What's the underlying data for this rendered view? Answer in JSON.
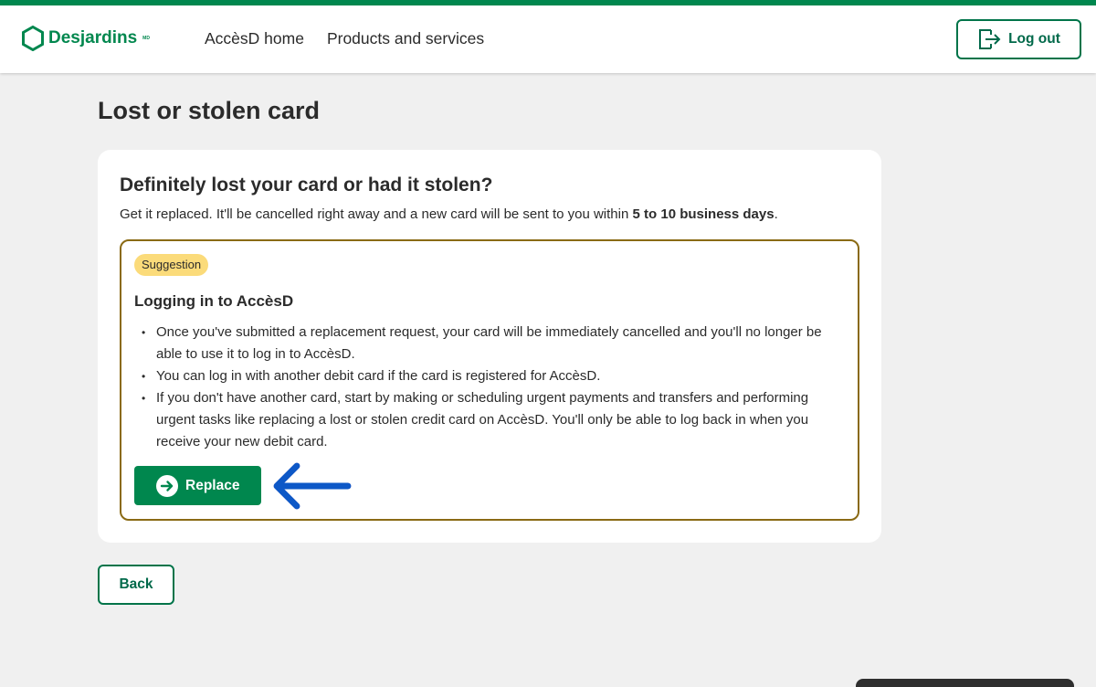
{
  "header": {
    "brand": "Desjardins",
    "brand_mark": "MD",
    "nav": [
      "AccèsD home",
      "Products and services"
    ],
    "logout_label": "Log out",
    "icons": {
      "logo": "hexagon-logo-icon",
      "logout": "logout-door-icon"
    }
  },
  "page": {
    "title": "Lost or stolen card"
  },
  "card": {
    "title": "Definitely lost your card or had it stolen?",
    "subtitle_prefix": "Get it replaced. It'll be cancelled right away and a new card will be sent to you within",
    "subtitle_bold": "5 to 10 business days",
    "subtitle_suffix": "."
  },
  "suggestion": {
    "badge": "Suggestion",
    "title": "Logging in to AccèsD",
    "items": [
      "Once you've submitted a replacement request, your card will be immediately cancelled and you'll no longer be able to use it to log in to AccèsD.",
      "You can log in with another debit card if the card is registered for AccèsD.",
      "If you don't have another card, start by making or scheduling urgent payments and transfers and performing urgent tasks like replacing a lost or stolen credit card on AccèsD. You'll only be able to log back in when you receive your new debit card."
    ],
    "replace_label": "Replace"
  },
  "back_label": "Back",
  "colors": {
    "brand_green": "#00874e",
    "button_text_green": "#00694a",
    "badge_yellow": "#fbdb7a",
    "suggestion_border": "#8a6a14",
    "annotation_arrow": "#0a58c7",
    "page_bg": "#f0f0f0"
  }
}
